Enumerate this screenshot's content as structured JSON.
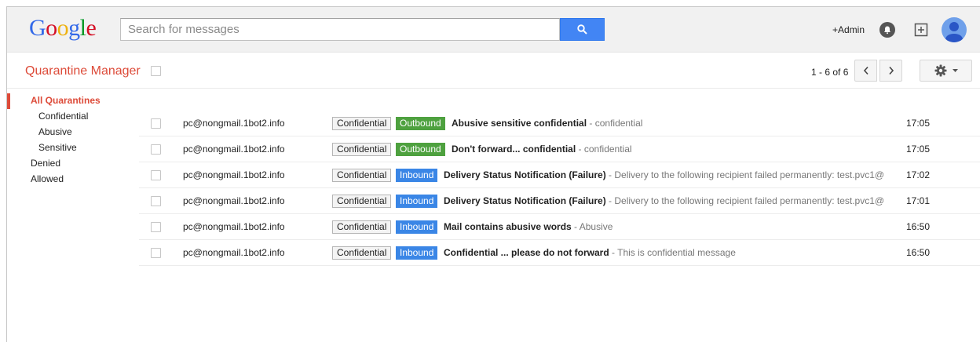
{
  "header": {
    "logo": [
      "G",
      "o",
      "o",
      "g",
      "l",
      "e"
    ],
    "search_placeholder": "Search for messages",
    "admin_label": "+Admin"
  },
  "toolbar": {
    "title": "Quarantine Manager",
    "pagination": "1 - 6 of 6"
  },
  "sidebar": {
    "items": [
      {
        "label": "All Quarantines"
      },
      {
        "label": "Confidential"
      },
      {
        "label": "Abusive"
      },
      {
        "label": "Sensitive"
      },
      {
        "label": "Denied"
      },
      {
        "label": "Allowed"
      }
    ]
  },
  "messages": [
    {
      "sender": "pc@nongmail.1bot2.info",
      "tag": "Confidential",
      "direction": "Outbound",
      "subject": "Abusive sensitive confidential",
      "snippet": " - confidential",
      "time": "17:05"
    },
    {
      "sender": "pc@nongmail.1bot2.info",
      "tag": "Confidential",
      "direction": "Outbound",
      "subject": "Don't forward... confidential",
      "snippet": " - confidential",
      "time": "17:05"
    },
    {
      "sender": "pc@nongmail.1bot2.info",
      "tag": "Confidential",
      "direction": "Inbound",
      "subject": "Delivery Status Notification (Failure)",
      "snippet": " - Delivery to the following recipient failed permanently: test.pvc1@",
      "time": "17:02"
    },
    {
      "sender": "pc@nongmail.1bot2.info",
      "tag": "Confidential",
      "direction": "Inbound",
      "subject": "Delivery Status Notification (Failure)",
      "snippet": " - Delivery to the following recipient failed permanently: test.pvc1@",
      "time": "17:01"
    },
    {
      "sender": "pc@nongmail.1bot2.info",
      "tag": "Confidential",
      "direction": "Inbound",
      "subject": "Mail contains abusive words",
      "snippet": " - Abusive",
      "time": "16:50"
    },
    {
      "sender": "pc@nongmail.1bot2.info",
      "tag": "Confidential",
      "direction": "Inbound",
      "subject": "Confidential ... please do not forward",
      "snippet": " - This is confidential message",
      "time": "16:50"
    }
  ],
  "colors": {
    "accent": "#dd4b39",
    "search_blue": "#4285f4",
    "outbound_green": "#4ea13f",
    "inbound_blue": "#3a86e6"
  },
  "icons": [
    "search-icon",
    "bell-icon",
    "add-box-icon",
    "avatar-icon",
    "chevron-left-icon",
    "chevron-right-icon",
    "gear-icon",
    "caret-down-icon"
  ]
}
